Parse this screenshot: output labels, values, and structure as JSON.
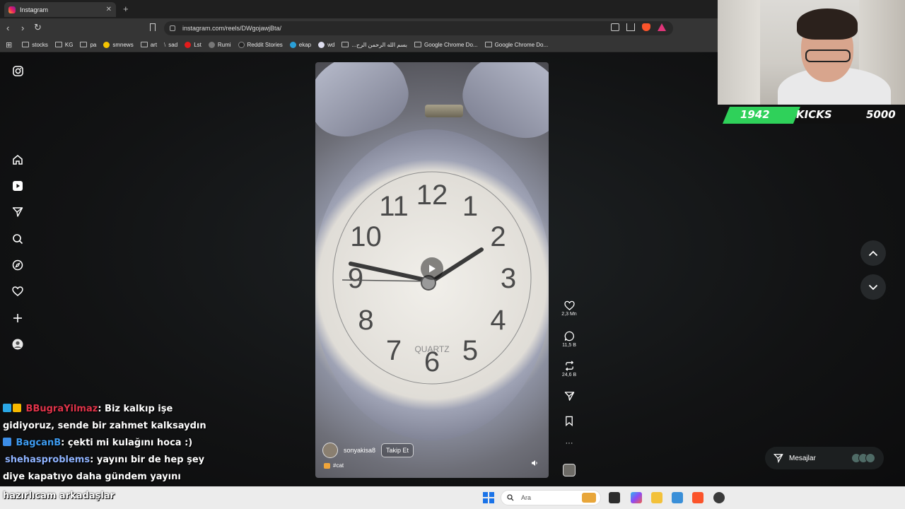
{
  "browser": {
    "tab_title": "Instagram",
    "url": "instagram.com/reels/DWgojawjBta/",
    "bookmarks": [
      "stocks",
      "KG",
      "pa",
      "smnews",
      "art",
      "sad",
      "Lst",
      "Rumi",
      "Reddit Stories",
      "ekap",
      "wd",
      "...بسم الله الرحمن الرح",
      "Google Chrome Do...",
      "Google Chrome Do..."
    ]
  },
  "sidebar": {
    "icons": [
      "instagram-logo-icon",
      "home-icon",
      "reels-icon",
      "send-icon",
      "search-icon",
      "explore-icon",
      "heart-icon",
      "create-icon",
      "profile-icon"
    ]
  },
  "reel": {
    "author": "sonyakisa8",
    "follow_label": "Takip Et",
    "tag": "#cat",
    "clock_brand": "QUARTZ",
    "clock_numbers": [
      "12",
      "1",
      "2",
      "3",
      "4",
      "5",
      "6",
      "7",
      "8",
      "9",
      "10",
      "11"
    ]
  },
  "actions": {
    "likes": "2,3 Mn",
    "comments": "11,5 B",
    "reposts": "24,6 B"
  },
  "messages": {
    "label": "Mesajlar"
  },
  "stream_counter": {
    "count": "1942",
    "label": "KICKS",
    "goal": "5000"
  },
  "chat": [
    {
      "user": "BBugraYilmaz",
      "user_color": "#e0344a",
      "text": ": Biz kalkıp işe gidiyoruz, sende bir zahmet kalksaydın"
    },
    {
      "user": "BagcanB",
      "user_color": "#3e9bf0",
      "text": ": çekti mi kulağını hoca :)"
    },
    {
      "user": "shehasproblems",
      "user_color": "#8fb3ff",
      "text": ": yayını bir de hep şey diye kapatıyo daha gündem yayını"
    },
    {
      "user": "",
      "user_color": "#ffffff",
      "text": "hazırlıcam arkadaşlar"
    }
  ],
  "taskbar": {
    "search_placeholder": "Ara"
  },
  "colors": {
    "accent": "#2fd15a",
    "page_bg": "#121314"
  }
}
